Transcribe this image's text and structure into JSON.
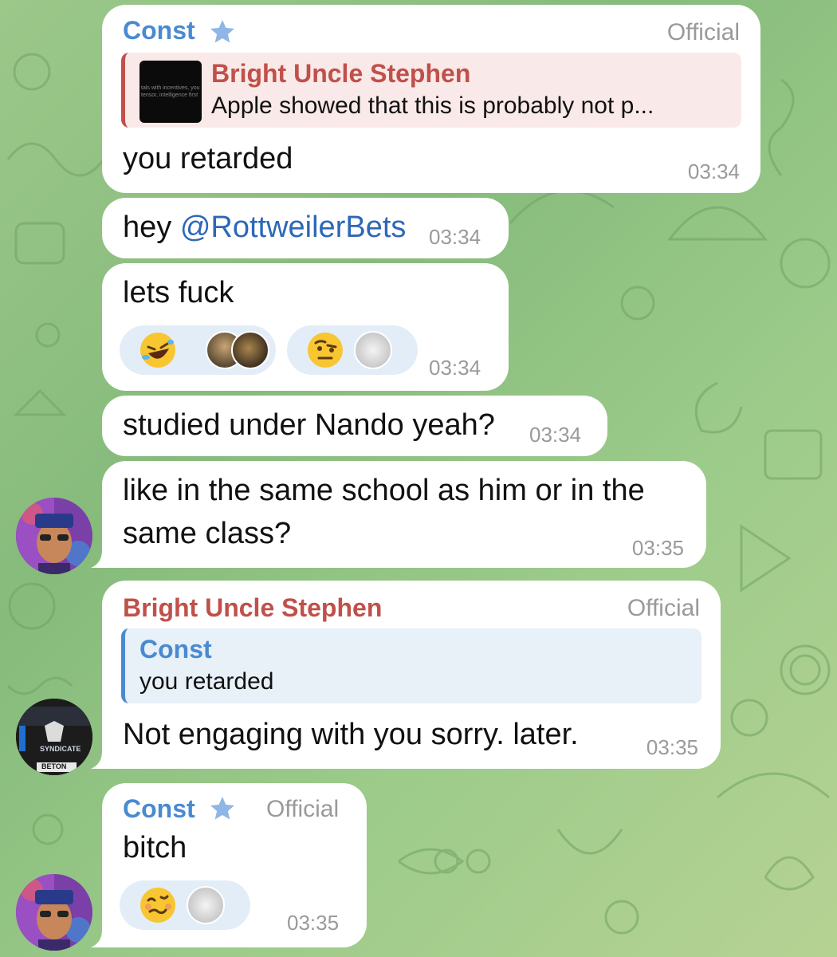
{
  "messages": [
    {
      "sender": "Const",
      "tag": "Official",
      "reply": {
        "name": "Bright Uncle Stephen",
        "text": "Apple showed that this is probably not p...",
        "thumb_text": "tals with incentives, you tensor, intelligence first"
      },
      "text": "you retarded",
      "time": "03:34"
    },
    {
      "text_prefix": "hey ",
      "mention": "@RottweilerBets",
      "time": "03:34"
    },
    {
      "text": "lets fuck",
      "reactions": [
        {
          "emoji": "rolling-on-floor-laughing",
          "avatars": [
            "painting-avatar",
            "painting-avatar-2"
          ]
        },
        {
          "emoji": "raised-eyebrow-face",
          "avatars": [
            "dog-avatar"
          ]
        }
      ],
      "time": "03:34"
    },
    {
      "text": "studied under Nando yeah?",
      "time": "03:34"
    },
    {
      "line1": "like in the same school as him or in the",
      "line2": "same class?",
      "time": "03:35"
    },
    {
      "sender": "Bright Uncle Stephen",
      "tag": "Official",
      "reply": {
        "name": "Const",
        "text": "you retarded"
      },
      "text": "Not engaging with you sorry.   later.",
      "time": "03:35",
      "avatar_text": [
        "SYNDICATE",
        "BETON"
      ]
    },
    {
      "sender": "Const",
      "tag": "Official",
      "text": "bitch",
      "reactions": [
        {
          "emoji": "woozy-face",
          "avatars": [
            "dog-avatar"
          ]
        }
      ],
      "time": "03:35"
    }
  ],
  "colors": {
    "accent_blue": "#4a8ad0",
    "accent_red": "#c0504a",
    "mention": "#2d67b8",
    "background": "#9cc88a"
  }
}
